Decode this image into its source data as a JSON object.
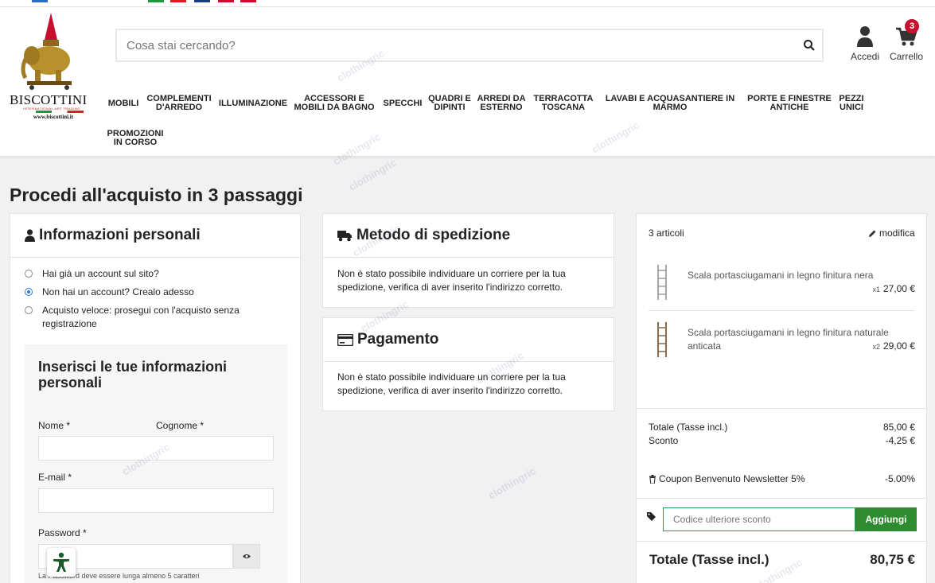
{
  "header": {
    "search_placeholder": "Cosa stai cercando?",
    "account_label": "Accedi",
    "cart_label": "Carrello",
    "cart_count": "3"
  },
  "logo": {
    "name": "BISCOTTINI",
    "tagline": "INTERNATIONAL ART TRADING",
    "url": "www.biscottini.it"
  },
  "nav": {
    "items": [
      "MOBILI",
      "COMPLEMENTI D'ARREDO",
      "ILLUMINAZIONE",
      "ACCESSORI E MOBILI DA BAGNO",
      "SPECCHI",
      "QUADRI E DIPINTI",
      "ARREDI DA ESTERNO",
      "TERRACOTTA TOSCANA",
      "LAVABI E ACQUASANTIERE IN MARMO",
      "PORTE E FINESTRE ANTICHE",
      "PEZZI UNICI",
      "PROMOZIONI IN CORSO"
    ]
  },
  "page": {
    "title": "Procedi all'acquisto in 3 passaggi"
  },
  "personal": {
    "heading": "Informazioni personali",
    "options": [
      "Hai già un account sul sito?",
      "Non hai un account? Crealo adesso",
      "Acquisto veloce: prosegui con l'acquisto senza registrazione"
    ],
    "form_title": "Inserisci le tue informazioni personali",
    "name_label": "Nome *",
    "surname_label": "Cognome *",
    "email_label": "E-mail *",
    "password_label": "Password *",
    "password_hint": "La Password deve essere lunga almeno 5 caratteri"
  },
  "shipping": {
    "heading": "Metodo di spedizione",
    "message": "Non è stato possibile individuare un corriere per la tua spedizione, verifica di aver inserito l'indirizzo corretto."
  },
  "payment": {
    "heading": "Pagamento",
    "message": "Non è stato possibile individuare un corriere per la tua spedizione, verifica di aver inserito l'indirizzo corretto."
  },
  "summary": {
    "count_label": "3 articoli",
    "edit_label": "modifica",
    "products": [
      {
        "name": "Scala portasciugamani in legno finitura nera",
        "qty": "x1",
        "price": "27,00 €"
      },
      {
        "name": "Scala portasciugamani in legno finitura naturale anticata",
        "qty": "x2",
        "price": "29,00 €"
      }
    ],
    "subtotal_label": "Totale (Tasse incl.)",
    "subtotal_value": "85,00 €",
    "discount_label": "Sconto",
    "discount_value": "-4,25 €",
    "coupon_label": "Coupon Benvenuto Newsletter 5%",
    "coupon_value": "-5.00%",
    "promo_placeholder": "Codice ulteriore sconto",
    "promo_button": "Aggiungi",
    "total_label": "Totale (Tasse incl.)",
    "total_value": "80,75 €"
  },
  "watermark": "clothingric",
  "colors": {
    "accent_green": "#2c8c2f",
    "badge_red": "#c8102e",
    "radio_blue": "#2a7ad0"
  }
}
